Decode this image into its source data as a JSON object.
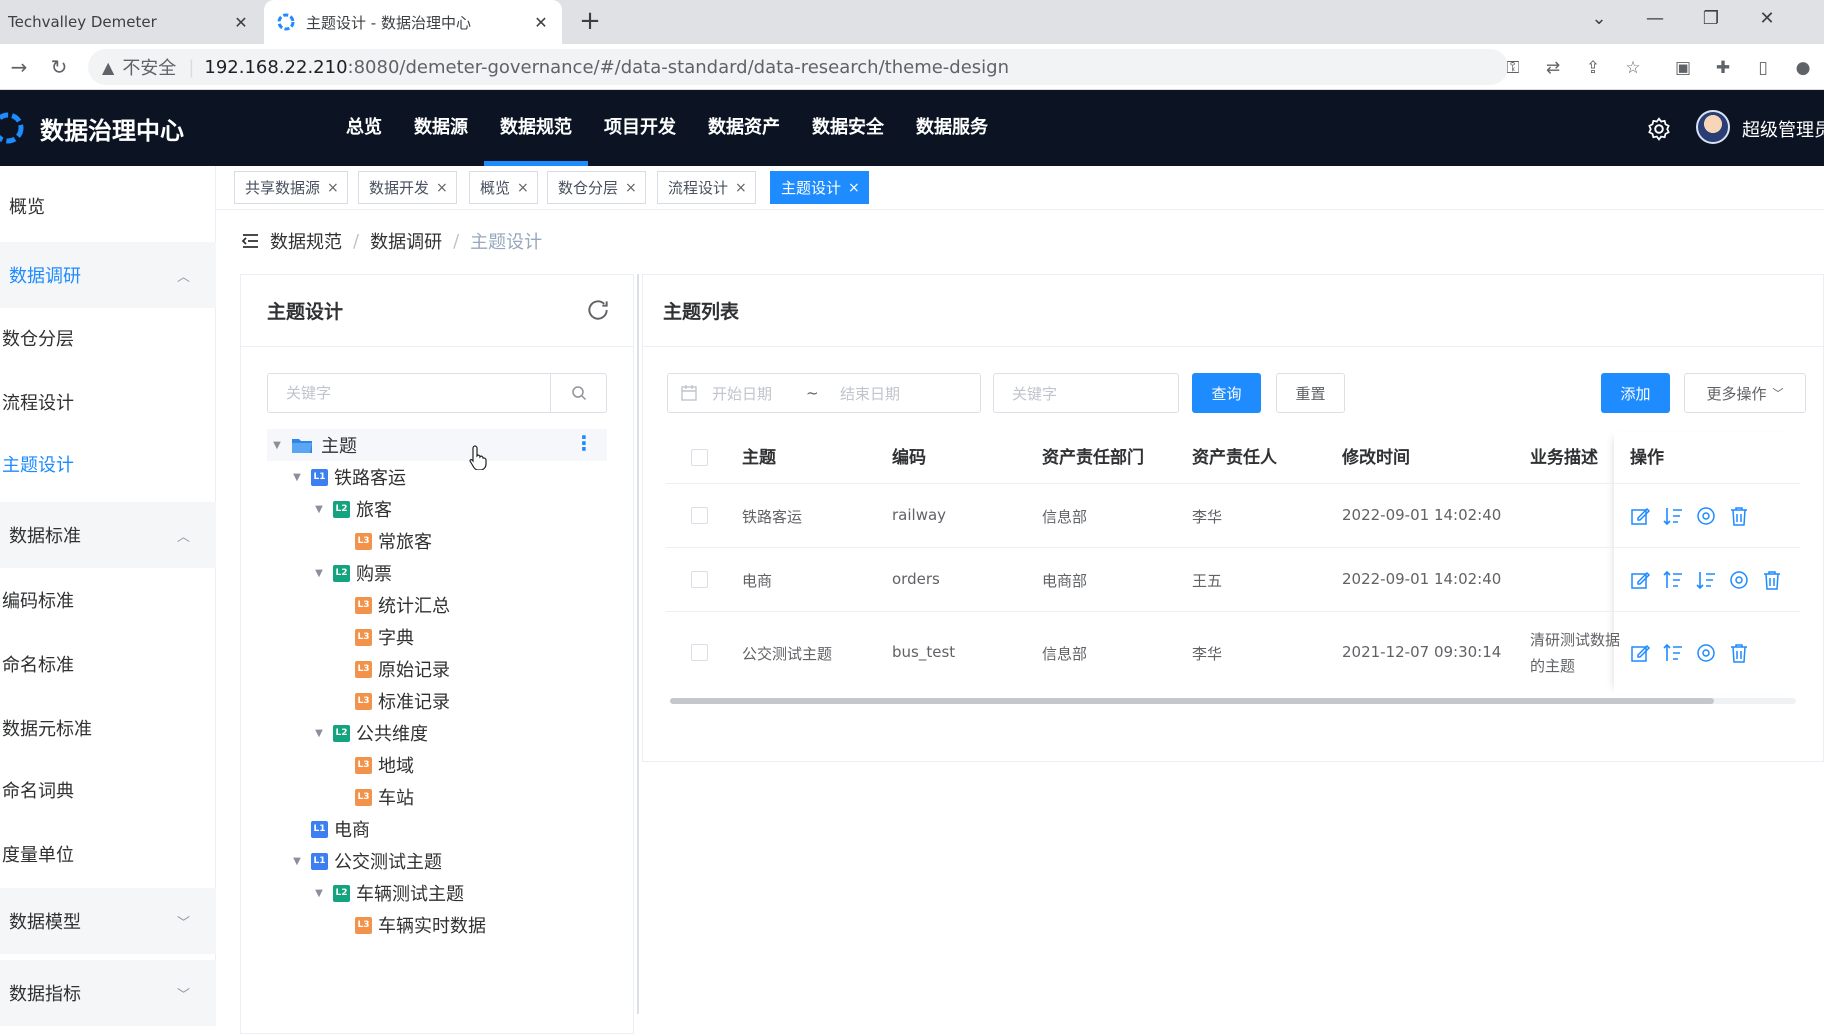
{
  "browser": {
    "tabs": [
      {
        "title": "Techvalley Demeter",
        "close": "✕"
      },
      {
        "title": "主题设计 - 数据治理中心",
        "close": "✕"
      }
    ],
    "new_tab": "+",
    "address": {
      "insecure_label": "不安全",
      "host": "192.168.22.210",
      "path": ":8080/demeter-governance/#/data-standard/data-research/theme-design"
    }
  },
  "app": {
    "name": "数据治理中心",
    "nav": [
      "总览",
      "数据源",
      "数据规范",
      "项目开发",
      "数据资产",
      "数据安全",
      "数据服务"
    ],
    "active_nav": "数据规范",
    "user": "超级管理员"
  },
  "sidebar": {
    "items": [
      {
        "label": "概览",
        "type": "item"
      },
      {
        "label": "数据调研",
        "type": "group",
        "arrow": "^"
      },
      {
        "label": "数仓分层",
        "type": "sub"
      },
      {
        "label": "流程设计",
        "type": "sub"
      },
      {
        "label": "主题设计",
        "type": "sub"
      },
      {
        "label": "数据标准",
        "type": "group",
        "arrow": "^"
      },
      {
        "label": "编码标准",
        "type": "sub"
      },
      {
        "label": "命名标准",
        "type": "sub"
      },
      {
        "label": "数据元标准",
        "type": "sub"
      },
      {
        "label": "命名词典",
        "type": "sub"
      },
      {
        "label": "度量单位",
        "type": "sub"
      },
      {
        "label": "数据模型",
        "type": "group",
        "arrow": "v"
      },
      {
        "label": "数据指标",
        "type": "group",
        "arrow": "v"
      }
    ]
  },
  "tags": [
    "共享数据源",
    "数据开发",
    "概览",
    "数仓分层",
    "流程设计",
    "主题设计"
  ],
  "tag_close": "×",
  "breadcrumb": [
    "数据规范",
    "数据调研",
    "主题设计"
  ],
  "breadcrumb_sep": "/",
  "left_panel": {
    "title": "主题设计",
    "search_placeholder": "关键字",
    "tree": [
      {
        "label": "主题",
        "level": "folder",
        "depth": 0,
        "expanded": true
      },
      {
        "label": "铁路客运",
        "level": "L1",
        "depth": 1,
        "expanded": true
      },
      {
        "label": "旅客",
        "level": "L2",
        "depth": 2,
        "expanded": true
      },
      {
        "label": "常旅客",
        "level": "L3",
        "depth": 3
      },
      {
        "label": "购票",
        "level": "L2",
        "depth": 2,
        "expanded": true
      },
      {
        "label": "统计汇总",
        "level": "L3",
        "depth": 3
      },
      {
        "label": "字典",
        "level": "L3",
        "depth": 3
      },
      {
        "label": "原始记录",
        "level": "L3",
        "depth": 3
      },
      {
        "label": "标准记录",
        "level": "L3",
        "depth": 3
      },
      {
        "label": "公共维度",
        "level": "L2",
        "depth": 2,
        "expanded": true
      },
      {
        "label": "地域",
        "level": "L3",
        "depth": 3
      },
      {
        "label": "车站",
        "level": "L3",
        "depth": 3
      },
      {
        "label": "电商",
        "level": "L1",
        "depth": 1
      },
      {
        "label": "公交测试主题",
        "level": "L1",
        "depth": 1,
        "expanded": true
      },
      {
        "label": "车辆测试主题",
        "level": "L2",
        "depth": 2,
        "expanded": true
      },
      {
        "label": "车辆实时数据",
        "level": "L3",
        "depth": 3
      }
    ]
  },
  "right_panel": {
    "title": "主题列表",
    "filters": {
      "start_date": "开始日期",
      "range_sep": "~",
      "end_date": "结束日期",
      "keyword": "关键字"
    },
    "buttons": {
      "query": "查询",
      "reset": "重置",
      "add": "添加",
      "more": "更多操作"
    },
    "columns": [
      "主题",
      "编码",
      "资产责任部门",
      "资产责任人",
      "修改时间",
      "业务描述",
      "操作"
    ],
    "rows": [
      {
        "theme": "铁路客运",
        "code": "railway",
        "dept": "信息部",
        "owner": "李华",
        "time": "2022-09-01 14:02:40",
        "desc": "",
        "ops": [
          "edit",
          "move-down",
          "view",
          "delete"
        ]
      },
      {
        "theme": "电商",
        "code": "orders",
        "dept": "电商部",
        "owner": "王五",
        "time": "2022-09-01 14:02:40",
        "desc": "",
        "ops": [
          "edit",
          "move-up",
          "move-down",
          "view",
          "delete"
        ]
      },
      {
        "theme": "公交测试主题",
        "code": "bus_test",
        "dept": "信息部",
        "owner": "李华",
        "time": "2021-12-07 09:30:14",
        "desc": "清研测试数据的主题",
        "desc_line1": "清研测试数据",
        "desc_line2": "的主题",
        "ops": [
          "edit",
          "move-up",
          "view",
          "delete"
        ]
      }
    ]
  },
  "colors": {
    "primary": "#1e8bff",
    "header_bg": "#0c1424",
    "L1": "#3b7ff0",
    "L2": "#14a37f",
    "L3": "#f3934b"
  }
}
